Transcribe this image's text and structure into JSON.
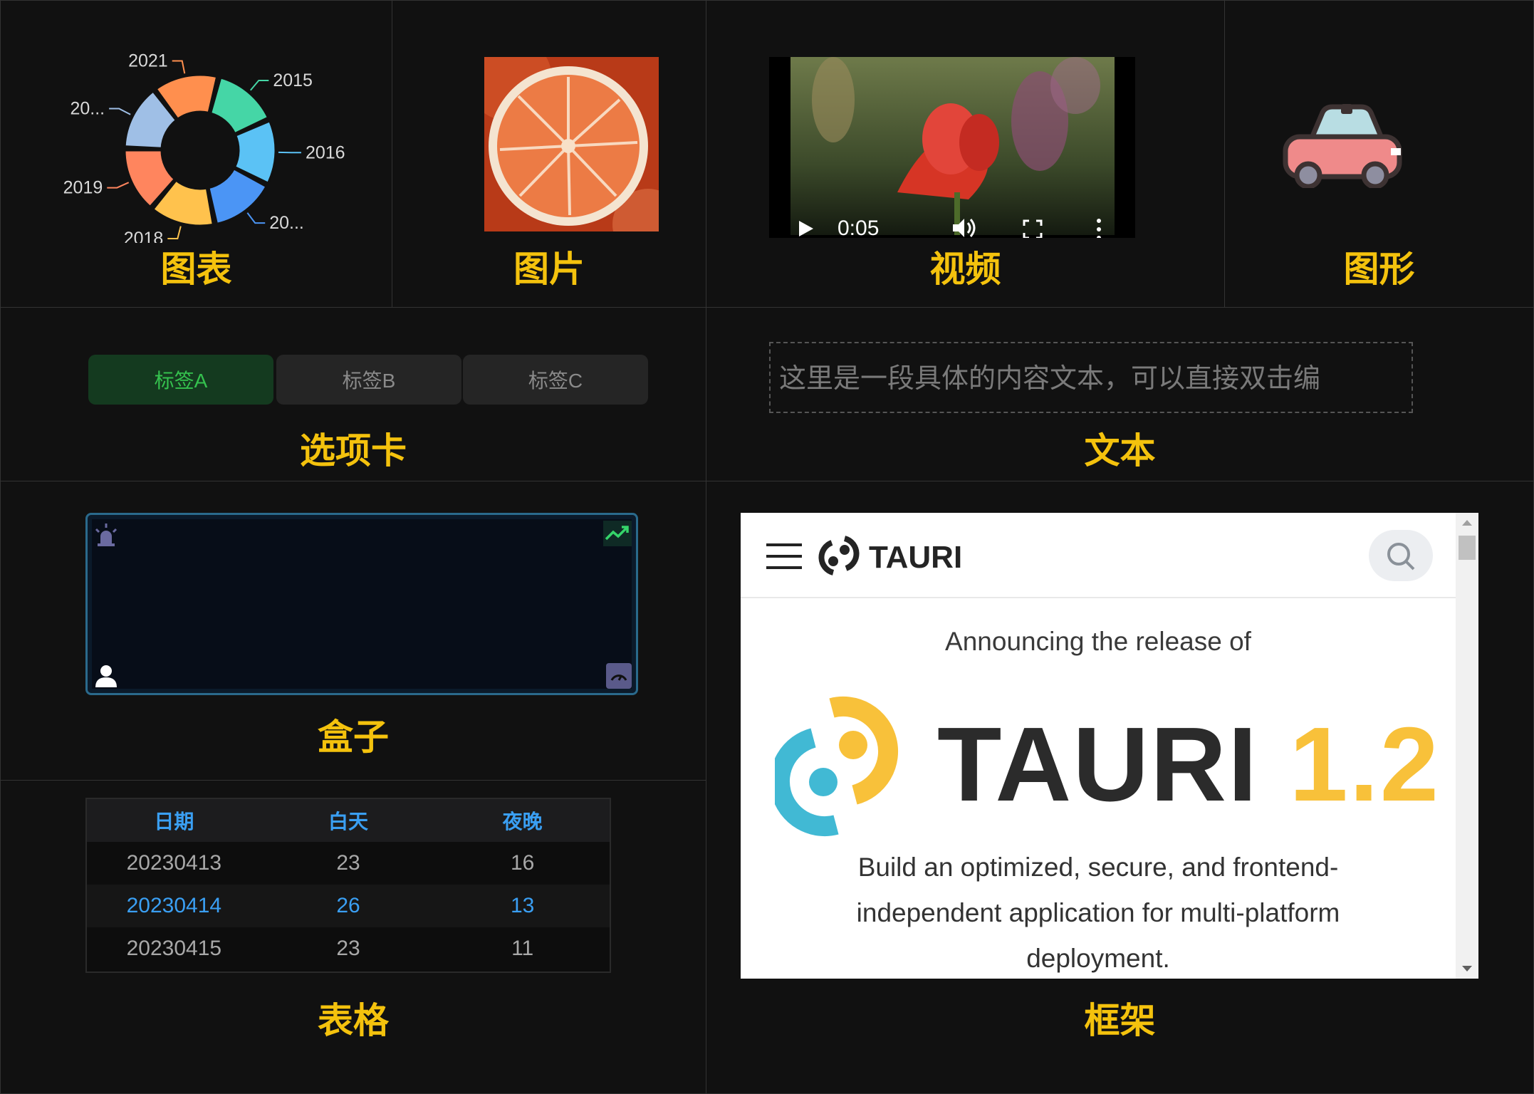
{
  "cards": {
    "chart": {
      "caption": "图表"
    },
    "image": {
      "caption": "图片"
    },
    "video": {
      "caption": "视频",
      "time": "0:05"
    },
    "shape": {
      "caption": "图形"
    },
    "tabs": {
      "caption": "选项卡",
      "items": [
        "标签A",
        "标签B",
        "标签C"
      ],
      "active_index": 0
    },
    "text": {
      "caption": "文本",
      "content": "这里是一段具体的内容文本，可以直接双击编"
    },
    "box": {
      "caption": "盒子"
    },
    "table": {
      "caption": "表格",
      "headers": [
        "日期",
        "白天",
        "夜晚"
      ],
      "rows": [
        [
          "20230413",
          "23",
          "16"
        ],
        [
          "20230414",
          "26",
          "13"
        ],
        [
          "20230415",
          "23",
          "11"
        ]
      ],
      "highlighted_row": 1
    },
    "frame": {
      "caption": "框架",
      "brand": "TAURI",
      "announce": "Announcing the release of",
      "headline_name": "TAURI",
      "headline_version": "1.2",
      "description": "Build an optimized, secure, and frontend-independent application for multi-platform deployment."
    }
  },
  "chart_data": {
    "type": "pie",
    "variant": "donut (rose)",
    "categories": [
      "2015",
      "2016",
      "20...",
      "2018",
      "2019",
      "20...",
      "2021"
    ],
    "values": [
      1,
      1,
      1,
      1,
      1,
      1,
      1
    ],
    "colors": [
      "#45d6a6",
      "#5bc2f5",
      "#4b95f5",
      "#ffc24d",
      "#ff855e",
      "#9fbfe6",
      "#ff8f4e"
    ],
    "legend": "none"
  },
  "colors": {
    "background": "#111111",
    "caption": "#f4c20d",
    "tab_active_text": "#35c14e",
    "table_header": "#3a9ff3",
    "tauri_yellow": "#f8c13a",
    "tauri_blue": "#41b9d4"
  },
  "icons": {
    "box_corners": [
      "alarm-light-icon",
      "trend-up-icon",
      "user-icon",
      "gauge-icon"
    ],
    "video_controls": [
      "play-icon",
      "volume-icon",
      "fullscreen-icon",
      "more-icon"
    ],
    "frame": [
      "menu-icon",
      "tauri-logo",
      "search-icon"
    ]
  }
}
